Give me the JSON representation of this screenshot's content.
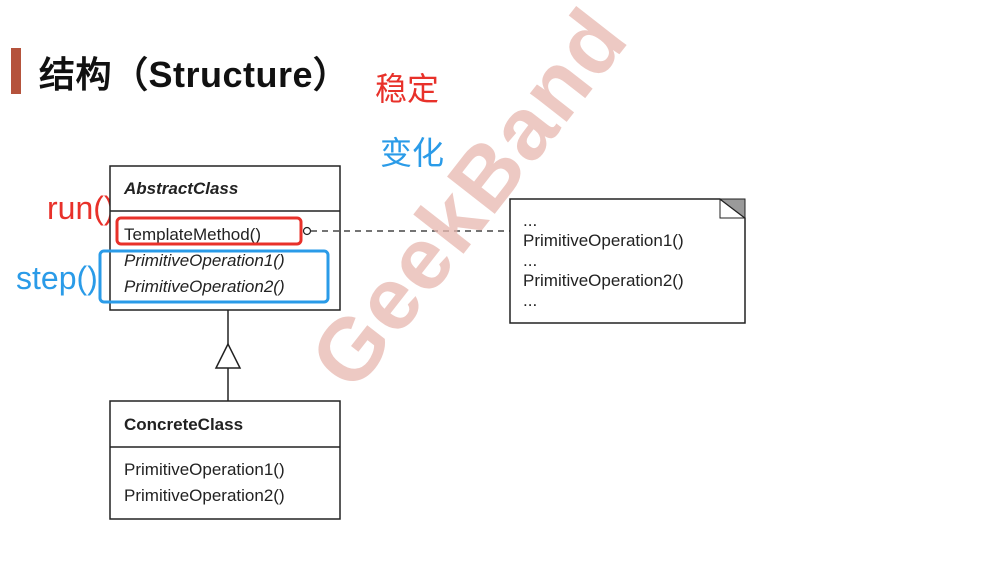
{
  "slide": {
    "title": "结构（Structure）",
    "annotations": {
      "stable": "稳定",
      "changing": "变化",
      "run": "run()",
      "step": "step()"
    },
    "watermark": "GeekBand",
    "colors": {
      "accent": "#b5533c",
      "red": "#e8312a",
      "blue": "#2a9be8"
    }
  },
  "diagram": {
    "abstract_class": {
      "name": "AbstractClass",
      "methods": [
        "TemplateMethod()",
        "PrimitiveOperation1()",
        "PrimitiveOperation2()"
      ]
    },
    "concrete_class": {
      "name": "ConcreteClass",
      "methods": [
        "PrimitiveOperation1()",
        "PrimitiveOperation2()"
      ]
    },
    "note": {
      "lines": [
        "...",
        "PrimitiveOperation1()",
        "...",
        "PrimitiveOperation2()",
        "..."
      ]
    }
  }
}
